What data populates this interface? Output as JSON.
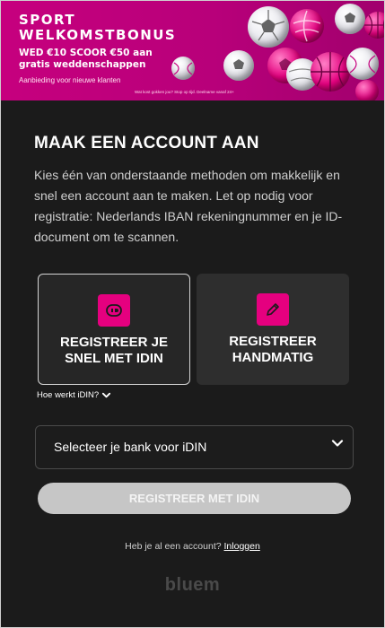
{
  "banner": {
    "title_line1": "SPORT",
    "title_line2": "WELKOMSTBONUS",
    "offer_line1": "WED €10 SCOOR €50 aan",
    "offer_line2": "gratis weddenschappen",
    "subtitle": "Aanbieding voor nieuwe klanten",
    "disclaimer": "Wat kost gokken jou? Stop op tijd. Deelname vanaf 24+"
  },
  "heading": "MAAK EEN ACCOUNT AAN",
  "intro": "Kies één van onderstaande methoden om makkelijk en snel een account aan te maken. Let op nodig voor registratie: Nederlands IBAN rekeningnummer en je ID-document om te scannen.",
  "options": {
    "idin": {
      "line1": "REGISTREER JE",
      "line2": "SNEL MET IDIN",
      "icon": "idin-icon"
    },
    "manual": {
      "line1": "REGISTREER",
      "line2": "HANDMATIG",
      "icon": "pencil-icon"
    }
  },
  "how_link": "Hoe werkt iDIN?",
  "bank_select": {
    "value": "Selecteer je bank voor iDIN"
  },
  "submit_label": "REGISTREER MET IDIN",
  "login": {
    "question": "Heb je al een account?",
    "link": "Inloggen"
  },
  "footer_brand": "bluem",
  "colors": {
    "accent": "#e5007f",
    "background": "#1b1b1b",
    "card": "#2a2a2a",
    "button_disabled": "#c6c6c6"
  }
}
